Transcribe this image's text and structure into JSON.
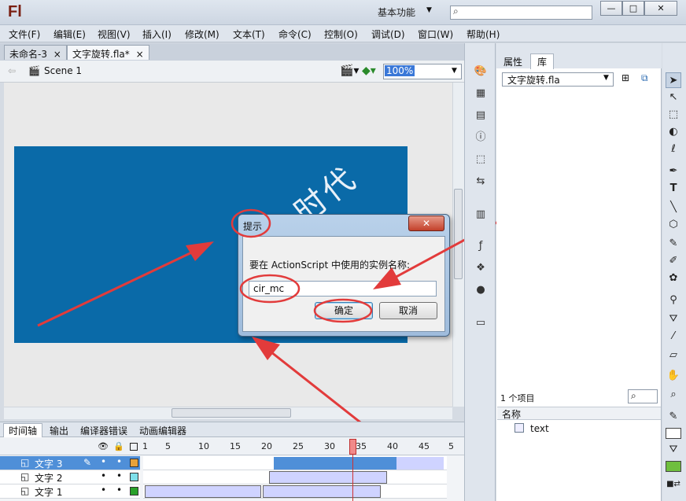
{
  "app": {
    "logo": "Fl",
    "workspace": "基本功能",
    "search_placeholder": ""
  },
  "window_buttons": [
    "—",
    "□",
    "✕"
  ],
  "menu": [
    "文件(F)",
    "编辑(E)",
    "视图(V)",
    "插入(I)",
    "修改(M)",
    "文本(T)",
    "命令(C)",
    "控制(O)",
    "调试(D)",
    "窗口(W)",
    "帮助(H)"
  ],
  "doc_tabs": [
    {
      "label": "未命名-3",
      "close": "×"
    },
    {
      "label": "文字旋转.fla*",
      "close": "×"
    }
  ],
  "editbar": {
    "scene": "Scene 1",
    "zoom": "100%"
  },
  "stage": {
    "rotated_text": "时代"
  },
  "dialog": {
    "title": "提示",
    "close": "✕",
    "prompt": "要在 ActionScript 中使用的实例名称:",
    "input_value": "cir_mc",
    "ok_label": "确定",
    "cancel_label": "取消"
  },
  "library": {
    "tab_properties": "属性",
    "tab_library": "库",
    "file": "文字旋转.fla",
    "count": "1 个项目",
    "col_name": "名称",
    "items": [
      {
        "name": "text"
      }
    ]
  },
  "timeline": {
    "tabs": [
      "时间轴",
      "输出",
      "编译器错误",
      "动画编辑器"
    ],
    "ruler": [
      "1",
      "5",
      "10",
      "15",
      "20",
      "25",
      "30",
      "35",
      "40",
      "45",
      "5"
    ],
    "layers": [
      {
        "name": "文字 3",
        "selected": true,
        "color": "#e8a23a"
      },
      {
        "name": "文字 2",
        "selected": false,
        "color": "#7fe0ea"
      },
      {
        "name": "文字 1",
        "selected": false,
        "color": "#2aa12a"
      }
    ]
  },
  "colors": {
    "accent": "#3a78d8",
    "stage": "#0a6aa8",
    "annotation": "#e23b3b"
  }
}
